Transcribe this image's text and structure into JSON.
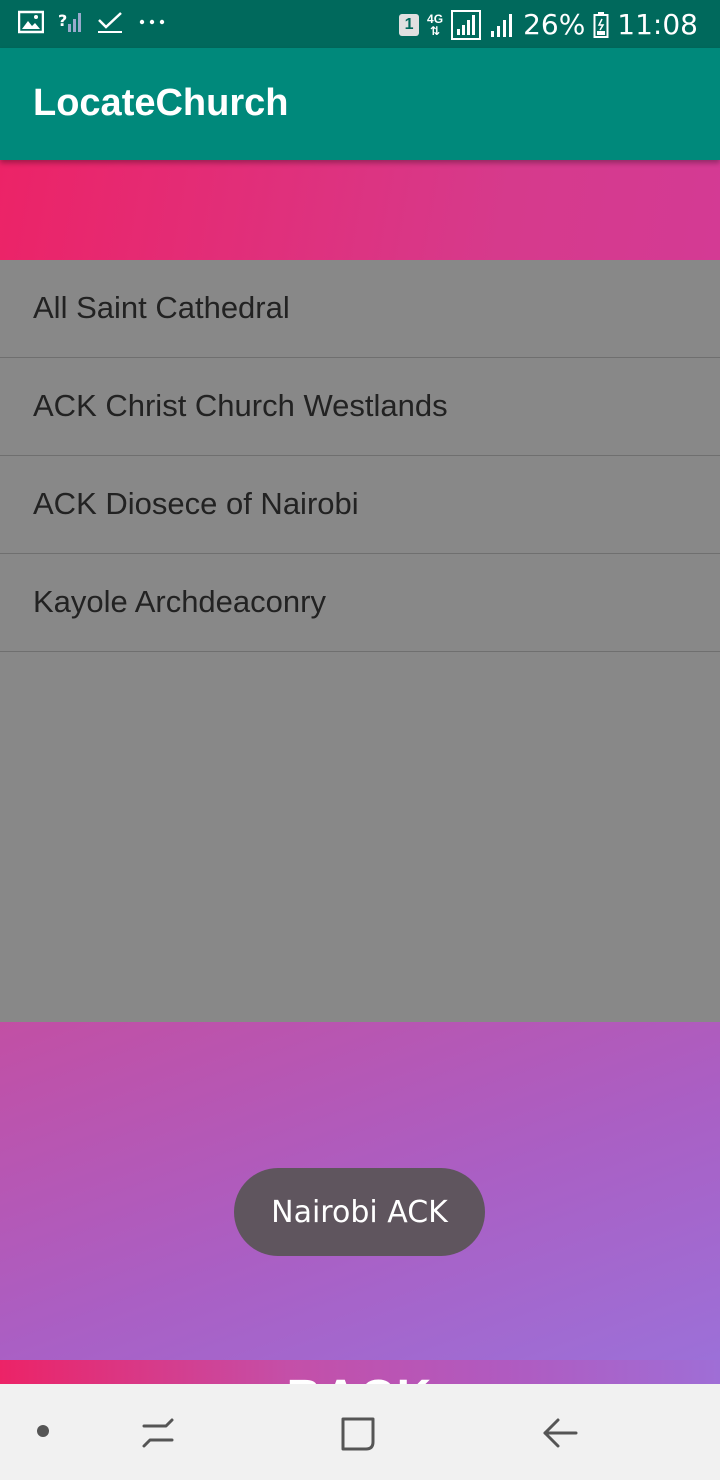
{
  "status_bar": {
    "left_icons": [
      "image-icon",
      "no-signal-icon",
      "check-icon",
      "more-dots-icon"
    ],
    "sim_badge": "1",
    "network_top": "4G",
    "network_bottom": "⇅",
    "battery_percent": "26%",
    "time": "11:08"
  },
  "app_bar": {
    "title": "LocateChurch"
  },
  "churches": [
    {
      "label": "All Saint Cathedral"
    },
    {
      "label": "ACK Christ Church Westlands"
    },
    {
      "label": "ACK Diosece of Nairobi"
    },
    {
      "label": "Kayole Archdeaconry"
    }
  ],
  "footer": {
    "back_label": "BACK"
  },
  "toast": {
    "text": "Nairobi ACK"
  },
  "nav_bar": {
    "icons": [
      "dot-icon",
      "recents-icon",
      "home-icon",
      "back-arrow-icon"
    ]
  },
  "colors": {
    "status_bar": "#00695c",
    "app_bar": "#00897b",
    "list_bg": "#888888",
    "accent_pink": "#ec2367",
    "accent_purple": "#9c70d8"
  }
}
